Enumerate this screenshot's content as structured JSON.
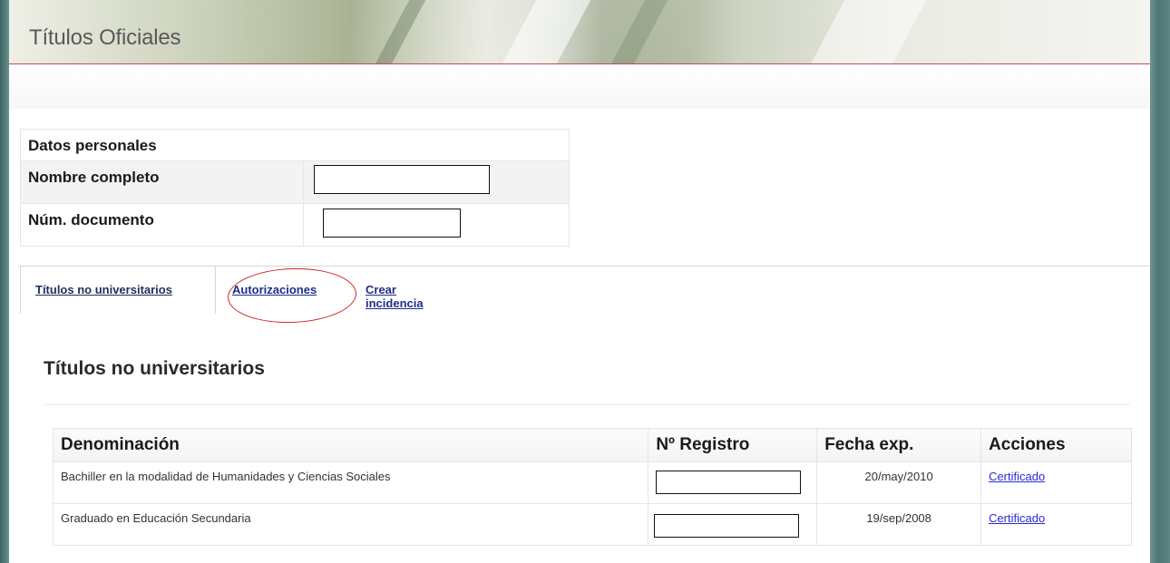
{
  "header": {
    "title": "Títulos Oficiales"
  },
  "personal": {
    "heading": "Datos personales",
    "full_name_label": "Nombre completo",
    "full_name_value": "",
    "document_label": "Núm. documento",
    "document_value": ""
  },
  "tabs": [
    {
      "label": "Títulos no universitarios",
      "active": true
    },
    {
      "label": "Autorizaciones",
      "active": false,
      "highlighted": true
    },
    {
      "label": "Crear incidencia",
      "active": false
    }
  ],
  "section": {
    "title": "Títulos no universitarios"
  },
  "table": {
    "columns": [
      "Denominación",
      "Nº Registro",
      "Fecha exp.",
      "Acciones"
    ],
    "rows": [
      {
        "denominacion": "Bachiller en la modalidad de Humanidades y Ciencias Sociales",
        "registro": "",
        "fecha": "20/may/2010",
        "accion": "Certificado"
      },
      {
        "denominacion": "Graduado en Educación Secundaria",
        "registro": "",
        "fecha": "19/sep/2008",
        "accion": "Certificado"
      }
    ]
  },
  "colors": {
    "header_underline": "#c94b4b",
    "highlight_ellipse": "#d22424",
    "link_blue": "#2a2ad4",
    "tab_link": "#1f2e8a",
    "frame_teal": "#557e7c"
  }
}
